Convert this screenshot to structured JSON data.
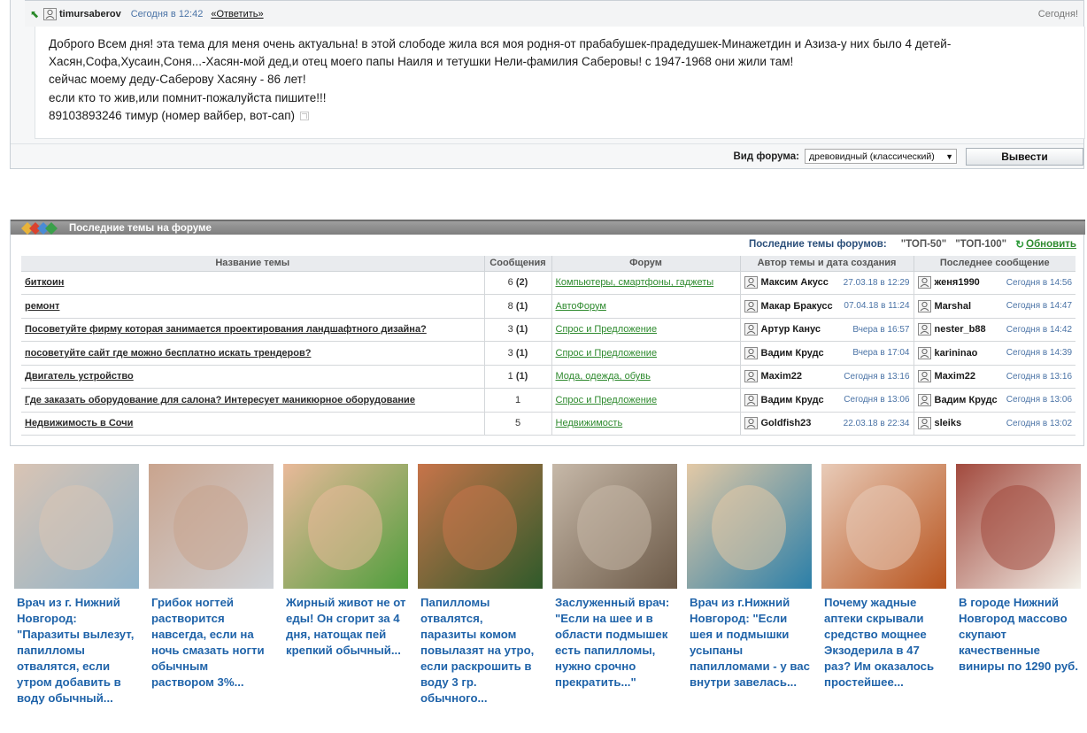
{
  "post": {
    "author": "timursaberov",
    "date": "Сегодня в 12:42",
    "reply_label": "«Ответить»",
    "today_label": "Сегодня!",
    "body_lines": [
      "Доброго Всем дня! эта тема для меня очень актуальна! в этой слободе жила вся моя родня-от прабабушек-прадедушек-Минажетдин и Азиза-у них было 4 детей-",
      "Хасян,Софа,Хусаин,Соня...-Хасян-мой дед,и отец моего папы Наиля и тетушки Нели-фамилия Саберовы! с 1947-1968 они жили там!",
      "сейчас моему деду-Саберову Хасяну - 86 лет!",
      "если кто то жив,или помнит-пожалуйста пишите!!!",
      "89103893246 тимур (номер вайбер, вот-сап)"
    ]
  },
  "view": {
    "label": "Вид форума:",
    "selected": "древовидный (классический)",
    "button": "Вывести"
  },
  "topics": {
    "header": "Последние темы на форуме",
    "sub_title": "Последние темы форумов:",
    "top50": "\"ТОП-50\"",
    "top100": "\"ТОП-100\"",
    "refresh": "Обновить",
    "columns": [
      "Название темы",
      "Сообщения",
      "Форум",
      "Автор темы и дата создания",
      "Последнее сообщение"
    ],
    "rows": [
      {
        "title": "биткоин",
        "count": "6",
        "new": "(2)",
        "forum": "Компьютеры, смартфоны, гаджеты",
        "author": "Максим Акусс",
        "author_date": "27.03.18 в 12:29",
        "last_user": "женя1990",
        "last_date": "Сегодня в 14:56"
      },
      {
        "title": "ремонт",
        "count": "8",
        "new": "(1)",
        "forum": "АвтоФорум",
        "author": "Макар Бракусс",
        "author_date": "07.04.18 в 11:24",
        "last_user": "Marshal",
        "last_date": "Сегодня в 14:47"
      },
      {
        "title": "Посоветуйте фирму которая занимается проектирования ландшафтного дизайна?",
        "count": "3",
        "new": "(1)",
        "forum": "Спрос и Предложение",
        "author": "Артур Канус",
        "author_date": "Вчера в 16:57",
        "last_user": "nester_b88",
        "last_date": "Сегодня в 14:42"
      },
      {
        "title": "посоветуйте сайт где можно бесплатно искать трендеров?",
        "count": "3",
        "new": "(1)",
        "forum": "Спрос и Предложение",
        "author": "Вадим Крудс",
        "author_date": "Вчера в 17:04",
        "last_user": "karininao",
        "last_date": "Сегодня в 14:39"
      },
      {
        "title": "Двигатель устройство",
        "count": "1",
        "new": "(1)",
        "forum": "Мода, одежда, обувь",
        "author": "Maxim22",
        "author_date": "Сегодня в 13:16",
        "last_user": "Maxim22",
        "last_date": "Сегодня в 13:16"
      },
      {
        "title": "Где заказать оборудование для салона? Интересует маникюрное оборудование",
        "count": "1",
        "new": "",
        "forum": "Спрос и Предложение",
        "author": "Вадим Крудс",
        "author_date": "Сегодня в 13:06",
        "last_user": "Вадим Крудс",
        "last_date": "Сегодня в 13:06"
      },
      {
        "title": "Недвижимость в Сочи",
        "count": "5",
        "new": "",
        "forum": "Недвижимость",
        "author": "Goldfish23",
        "author_date": "22.03.18 в 22:34",
        "last_user": "sleiks",
        "last_date": "Сегодня в 13:02"
      }
    ]
  },
  "ads": [
    {
      "text": "Врач из г. Нижний Новгород: \"Паразиты вылезут, папилломы отвалятся, если утром добавить в воду обычный...",
      "image": "doctor-woman-mask",
      "colors": [
        "#d9c4b4",
        "#8fb3c9"
      ]
    },
    {
      "text": "Грибок ногтей растворится навсегда, если на ночь смазать ногти обычным раствором 3%...",
      "image": "foil-wrapped-toes",
      "colors": [
        "#c9a48e",
        "#cfd3d8"
      ]
    },
    {
      "text": "Жирный живот не от еды! Он сгорит за 4 дня, натощак пей крепкий обычный...",
      "image": "belly-illustration",
      "colors": [
        "#e9b99a",
        "#4f9e3c"
      ]
    },
    {
      "text": "Папилломы отвалятся, паразиты комом повылазят на утро, если раскрошить в воду 3 гр. обычного...",
      "image": "textured-fruit",
      "colors": [
        "#c7744a",
        "#2f5a2a"
      ]
    },
    {
      "text": "Заслуженный врач: \"Если на шее и в области подмышек есть папилломы, нужно срочно прекратить...\"",
      "image": "doctor-man-glasses",
      "colors": [
        "#c6b8a8",
        "#6c5a48"
      ]
    },
    {
      "text": "Врач из г.Нижний Новгород: \"Если шея и подмышки усыпаны папилломами - у вас внутри завелась...",
      "image": "doctor-woman-blonde",
      "colors": [
        "#e3c9a6",
        "#2b7fa8"
      ]
    },
    {
      "text": "Почему жадные аптеки скрывали средство мощнее Экзодерила в 47 раз? Им оказалось простейшее...",
      "image": "toenail-powder",
      "colors": [
        "#e8cbb8",
        "#b8541e"
      ]
    },
    {
      "text": "В городе Нижний Новгород массово скупают качественные виниры по 1290 руб.",
      "image": "teeth-smile",
      "colors": [
        "#a24a3e",
        "#f3f1ea"
      ]
    }
  ]
}
